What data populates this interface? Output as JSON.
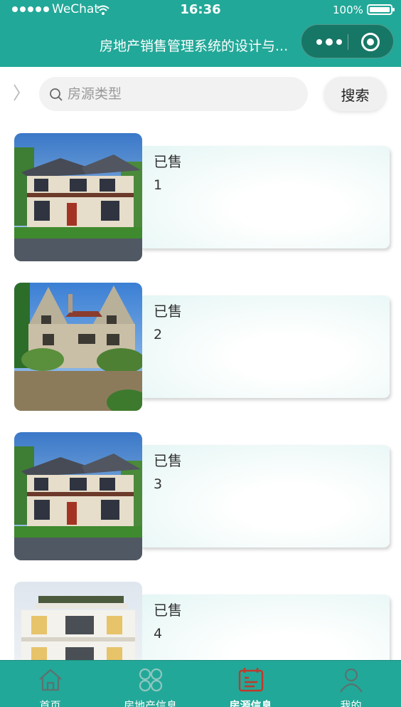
{
  "status_bar": {
    "carrier": "WeChat",
    "time": "16:36",
    "battery": "100%"
  },
  "nav": {
    "title": "房地产销售管理系统的设计与..."
  },
  "search": {
    "placeholder": "房源类型",
    "button_label": "搜索"
  },
  "listings": [
    {
      "status": "已售",
      "number": "1",
      "image": "villa-modern"
    },
    {
      "status": "已售",
      "number": "2",
      "image": "stone-manor"
    },
    {
      "status": "已售",
      "number": "3",
      "image": "villa-modern"
    },
    {
      "status": "已售",
      "number": "4",
      "image": "white-villa"
    }
  ],
  "tabbar": {
    "active_color": "#c0392b",
    "items": [
      {
        "label": "首页",
        "icon": "home-icon"
      },
      {
        "label": "房地产信息",
        "icon": "grid-icon"
      },
      {
        "label": "房源信息",
        "icon": "calendar-icon",
        "active": true
      },
      {
        "label": "我的",
        "icon": "user-icon"
      }
    ]
  },
  "colors": {
    "theme": "#22a898",
    "capsule": "#177766"
  }
}
